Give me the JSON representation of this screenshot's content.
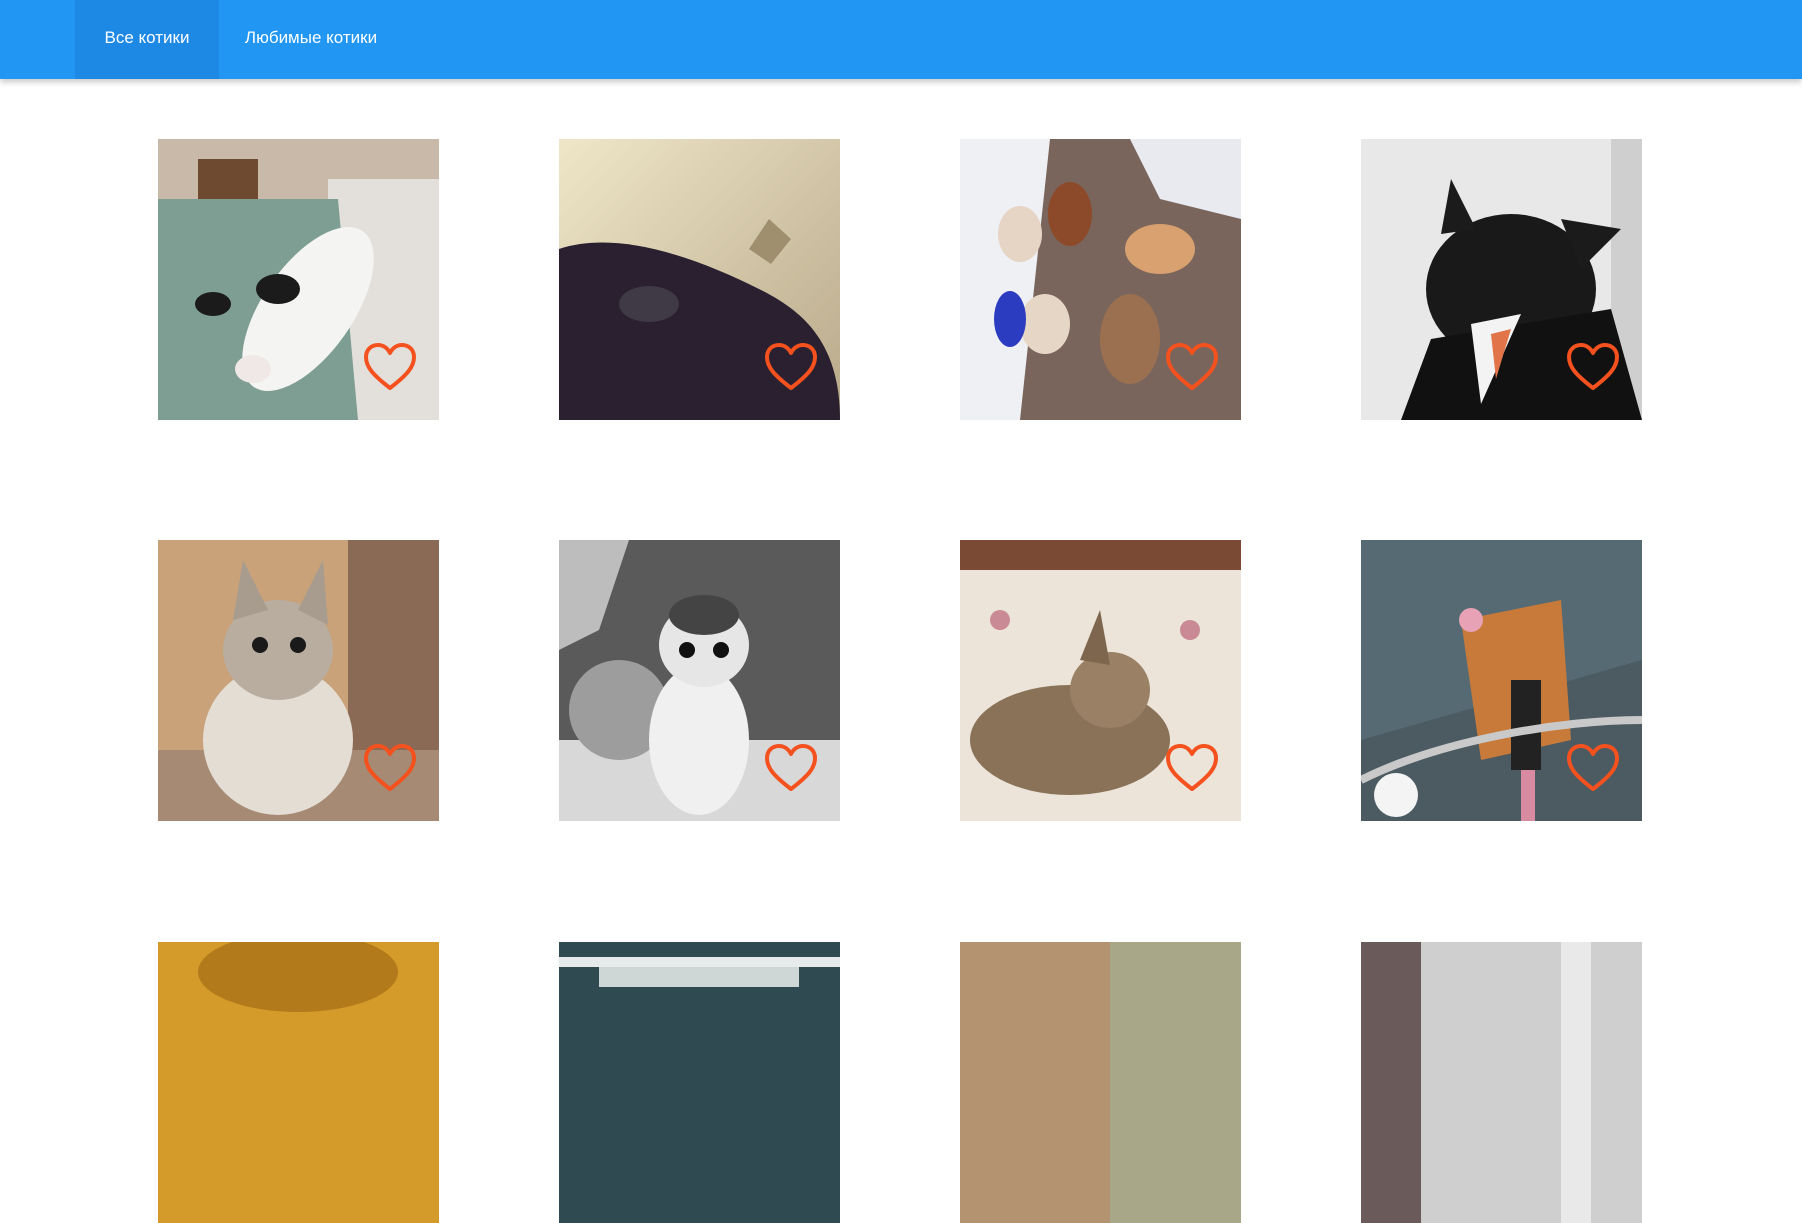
{
  "nav": {
    "tabs": [
      {
        "label": "Все котики",
        "active": true
      },
      {
        "label": "Любимые котики",
        "active": false
      }
    ]
  },
  "colors": {
    "header": "#2196F3",
    "header_active_tab": "#1E88E5",
    "heart": "#F4511E"
  },
  "cards": [
    {
      "icon": "heart-outline-icon",
      "liked": false
    },
    {
      "icon": "heart-outline-icon",
      "liked": false
    },
    {
      "icon": "heart-outline-icon",
      "liked": false
    },
    {
      "icon": "heart-outline-icon",
      "liked": false
    },
    {
      "icon": "heart-outline-icon",
      "liked": false
    },
    {
      "icon": "heart-outline-icon",
      "liked": false
    },
    {
      "icon": "heart-outline-icon",
      "liked": false
    },
    {
      "icon": "heart-outline-icon",
      "liked": false
    },
    {
      "icon": "heart-outline-icon",
      "liked": false
    },
    {
      "icon": "heart-outline-icon",
      "liked": false
    },
    {
      "icon": "heart-outline-icon",
      "liked": false
    },
    {
      "icon": "heart-outline-icon",
      "liked": false
    }
  ]
}
